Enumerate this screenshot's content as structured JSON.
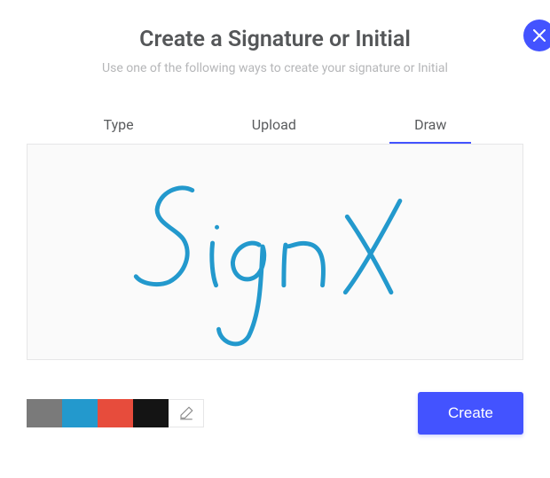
{
  "header": {
    "title": "Create a Signature or Initial",
    "subtitle": "Use one of the following ways to create your signature or Initial"
  },
  "tabs": {
    "type": "Type",
    "upload": "Upload",
    "draw": "Draw",
    "active": "draw"
  },
  "palette": {
    "colors": [
      "#7a7a7a",
      "#2399cd",
      "#e74c3c",
      "#141414"
    ],
    "selected": "#2399cd"
  },
  "actions": {
    "create": "Create"
  },
  "signature_text": "SignX"
}
